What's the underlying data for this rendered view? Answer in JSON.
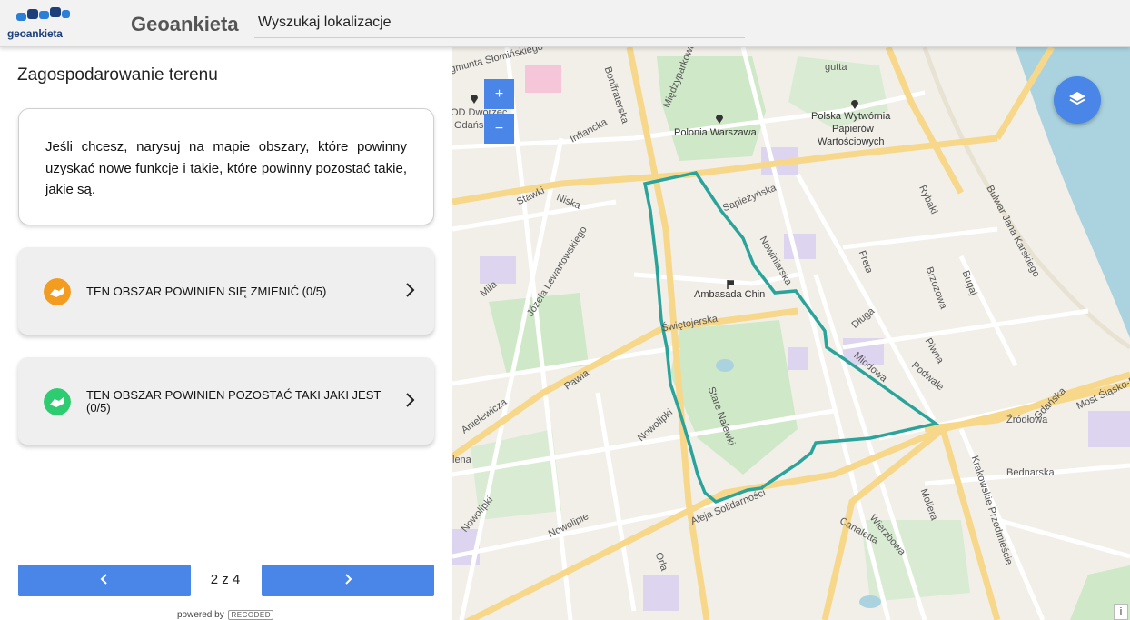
{
  "header": {
    "logo_text": "geoankieta",
    "app_title": "Geoankieta",
    "search_placeholder": "Wyszukaj lokalizacje"
  },
  "panel": {
    "section_title": "Zagospodarowanie terenu",
    "info_text": "Jeśli chcesz, narysuj na mapie obszary, które powinny uzyskać nowe funkcje i takie, które powinny pozostać takie, jakie są.",
    "options": [
      {
        "label": "TEN OBSZAR POWINIEN SIĘ ZMIENIĆ (0/5)",
        "color": "#f39c1f"
      },
      {
        "label": "TEN OBSZAR POWINIEN POZOSTAĆ TAKI JAKI JEST (0/5)",
        "color": "#2ecc71"
      }
    ],
    "page_counter": "2 z 4",
    "powered_by": "powered by",
    "powered_brand": "RECODED"
  },
  "map": {
    "zoom_in": "+",
    "zoom_out": "−",
    "accent_color": "#4a86e8",
    "polygon_color": "#2aa39a",
    "labels": {
      "polonia": "Polonia Warszawa",
      "pwpw1": "Polska Wytwórnia",
      "pwpw2": "Papierów",
      "pwpw3": "Wartościowych",
      "ambasada": "Ambasada Chin",
      "gutta": "gutta",
      "dworzec1": "OD Dworzec",
      "dworzec2": "Gdańs",
      "monument": "gmunta Słomińskiego",
      "bonifraterska": "Bonifraterska",
      "miedzyparkowa": "Międzyparkowa",
      "inflancka": "Inflancka",
      "stawki": "Stawki",
      "niska": "Niska",
      "sapiezynska": "Sapieżyńska",
      "nowiniarska": "Nowiniarska",
      "lewartowskiego": "Józefa Lewartowskiego",
      "mila": "Miła",
      "swietojerska": "Świętojerska",
      "freta": "Freta",
      "dluga": "Długa",
      "brzozowa": "Brzozowa",
      "bugaj": "Bugaj",
      "rybaki": "Rybaki",
      "karskiego": "Bulwar Jana Karskiego",
      "anielewicza": "Anielewicza",
      "pawia": "Pawia",
      "nowolipki": "Nowolipki",
      "stare_nalewki": "Stare Nalewki",
      "miodowa": "Miodowa",
      "piwna": "Piwna",
      "podwale": "Podwale",
      "zrodlowa": "Źródłowa",
      "goraka": "Gdańska",
      "most": "Most Śląsko-Dąb",
      "solidarnosci": "Aleja Solidarności",
      "nowolipie": "Nowolipie",
      "wolipki": "Nowolipki",
      "bednarska": "Bednarska",
      "krakowskie": "Krakowskie Przedmieście",
      "canaletta": "Canaletta",
      "wierzbowa": "Wierzbowa",
      "moliera": "Moliera",
      "orla": "Orla",
      "lena": "lena",
      "info": "i"
    }
  }
}
